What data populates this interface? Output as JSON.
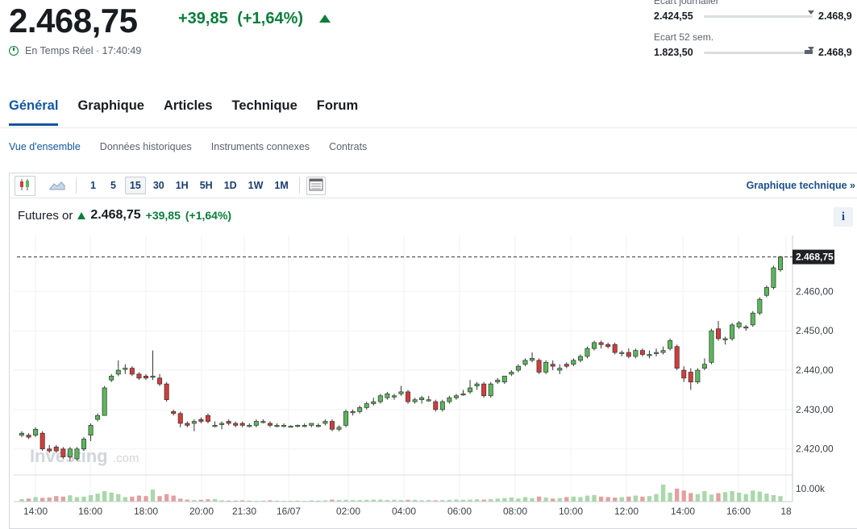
{
  "quote": {
    "price": "2.468,75",
    "change": "+39,85",
    "change_pct": "(+1,64%)",
    "realtime_label": "En Temps Réel · 17:40:49",
    "up_color": "#0a7e3a"
  },
  "ranges": {
    "daily": {
      "label": "Ecart journalier",
      "low": "2.424,55",
      "high": "2.468,9"
    },
    "week52": {
      "label": "Ecart 52 sem.",
      "low": "1.823,50",
      "high": "2.468,9"
    }
  },
  "main_tabs": [
    "Général",
    "Graphique",
    "Articles",
    "Technique",
    "Forum"
  ],
  "sub_tabs": [
    "Vue d'ensemble",
    "Données historiques",
    "Instruments connexes",
    "Contrats"
  ],
  "toolbar": {
    "icons": [
      "candlestick-icon",
      "area-chart-icon",
      "table-icon"
    ],
    "intervals": [
      "1",
      "5",
      "15",
      "30",
      "1H",
      "5H",
      "1D",
      "1W",
      "1M"
    ],
    "selected_interval": "15",
    "tech_link": "Graphique technique »"
  },
  "instrument": {
    "name": "Futures or",
    "price": "2.468,75",
    "change": "+39,85",
    "change_pct": "(+1,64%)"
  },
  "watermark": {
    "brand": "Investing",
    "suffix": ".com"
  },
  "chart_data": {
    "type": "candlestick",
    "y_ticks": [
      "2.420,00",
      "2.430,00",
      "2.440,00",
      "2.450,00",
      "2.460,00"
    ],
    "y_tick_values": [
      2420,
      2430,
      2440,
      2450,
      2460
    ],
    "ylim": [
      2413.6,
      2474.2
    ],
    "last_price_label": "2.468,75",
    "last_price": 2468.75,
    "volume_label": "10.00k",
    "x_ticks": [
      "14:00",
      "16:00",
      "18:00",
      "20:00",
      "21:30",
      "16/07",
      "02:00",
      "04:00",
      "06:00",
      "08:00",
      "10:00",
      "12:00",
      "14:00",
      "16:00",
      "18"
    ],
    "up_color": "#5bb75b",
    "down_color": "#d23c3c",
    "candles": [
      [
        2423.5,
        2424.5,
        2423.0,
        2424.0
      ],
      [
        2423.5,
        2424.0,
        2422.5,
        2423.0
      ],
      [
        2423.5,
        2425.5,
        2423.0,
        2425.0
      ],
      [
        2424.0,
        2424.5,
        2419.5,
        2420.0
      ],
      [
        2420.0,
        2421.0,
        2419.0,
        2419.5
      ],
      [
        2420.5,
        2421.0,
        2419.0,
        2419.5
      ],
      [
        2420.0,
        2420.5,
        2417.5,
        2418.0
      ],
      [
        2418.0,
        2420.5,
        2417.0,
        2420.0
      ],
      [
        2417.5,
        2420.5,
        2417.0,
        2420.0
      ],
      [
        2420.0,
        2423.0,
        2419.5,
        2422.5
      ],
      [
        2423.5,
        2426.5,
        2422.0,
        2426.0
      ],
      [
        2427.5,
        2429.0,
        2427.0,
        2428.5
      ],
      [
        2428.5,
        2436.0,
        2428.5,
        2435.5
      ],
      [
        2437.5,
        2439.0,
        2437.0,
        2438.5
      ],
      [
        2439.0,
        2442.5,
        2438.5,
        2440.0
      ],
      [
        2440.5,
        2441.5,
        2439.0,
        2440.5
      ],
      [
        2440.5,
        2441.0,
        2438.5,
        2439.0
      ],
      [
        2439.0,
        2439.5,
        2437.5,
        2438.0
      ],
      [
        2438.5,
        2439.0,
        2437.5,
        2438.0
      ],
      [
        2438.5,
        2445.0,
        2437.5,
        2438.5
      ],
      [
        2438.0,
        2439.0,
        2436.0,
        2436.5
      ],
      [
        2436.5,
        2437.0,
        2432.0,
        2432.5
      ],
      [
        2429.5,
        2430.0,
        2428.5,
        2429.0
      ],
      [
        2429.0,
        2429.5,
        2425.5,
        2426.5
      ],
      [
        2426.5,
        2427.0,
        2425.5,
        2426.0
      ],
      [
        2426.5,
        2427.5,
        2424.5,
        2427.0
      ],
      [
        2427.5,
        2428.0,
        2426.5,
        2427.0
      ],
      [
        2428.5,
        2429.0,
        2426.5,
        2427.0
      ],
      [
        2426.0,
        2427.0,
        2425.5,
        2426.0
      ],
      [
        2426.5,
        2427.0,
        2425.0,
        2426.5
      ],
      [
        2427.0,
        2427.5,
        2426.0,
        2426.5
      ],
      [
        2426.5,
        2427.0,
        2425.5,
        2426.0
      ],
      [
        2426.5,
        2427.0,
        2425.5,
        2426.0
      ],
      [
        2426.0,
        2426.5,
        2425.5,
        2426.0
      ],
      [
        2426.0,
        2427.5,
        2425.5,
        2427.0
      ],
      [
        2427.0,
        2427.5,
        2426.5,
        2427.0
      ],
      [
        2426.5,
        2427.0,
        2425.5,
        2426.0
      ],
      [
        2426.0,
        2426.5,
        2425.5,
        2426.0
      ],
      [
        2426.0,
        2426.5,
        2425.5,
        2426.0
      ],
      [
        2425.8,
        2426.0,
        2425.5,
        2425.8
      ],
      [
        2425.8,
        2426.2,
        2425.5,
        2426.0
      ],
      [
        2426.0,
        2426.5,
        2425.5,
        2426.0
      ],
      [
        2426.0,
        2426.5,
        2425.5,
        2426.5
      ],
      [
        2426.0,
        2426.5,
        2425.5,
        2426.0
      ],
      [
        2426.5,
        2427.5,
        2426.0,
        2427.0
      ],
      [
        2427.0,
        2427.5,
        2424.5,
        2425.0
      ],
      [
        2425.0,
        2426.0,
        2424.5,
        2425.5
      ],
      [
        2426.0,
        2430.0,
        2425.5,
        2429.5
      ],
      [
        2429.5,
        2430.0,
        2428.5,
        2429.5
      ],
      [
        2429.5,
        2431.0,
        2429.0,
        2430.5
      ],
      [
        2430.5,
        2432.0,
        2430.0,
        2431.5
      ],
      [
        2431.5,
        2433.0,
        2431.0,
        2432.0
      ],
      [
        2432.0,
        2434.0,
        2431.5,
        2433.5
      ],
      [
        2433.0,
        2434.5,
        2432.5,
        2434.0
      ],
      [
        2433.5,
        2434.0,
        2432.5,
        2433.5
      ],
      [
        2434.0,
        2436.0,
        2433.5,
        2434.5
      ],
      [
        2434.5,
        2435.0,
        2431.5,
        2432.0
      ],
      [
        2432.0,
        2433.0,
        2431.5,
        2432.5
      ],
      [
        2432.5,
        2433.5,
        2431.5,
        2433.0
      ],
      [
        2432.5,
        2433.5,
        2432.0,
        2432.5
      ],
      [
        2432.0,
        2432.5,
        2429.5,
        2430.0
      ],
      [
        2430.0,
        2432.5,
        2429.5,
        2432.0
      ],
      [
        2432.0,
        2433.5,
        2431.5,
        2433.0
      ],
      [
        2433.0,
        2434.0,
        2432.5,
        2433.5
      ],
      [
        2434.0,
        2435.0,
        2433.5,
        2434.0
      ],
      [
        2434.5,
        2437.5,
        2434.0,
        2435.5
      ],
      [
        2436.0,
        2437.0,
        2435.0,
        2436.5
      ],
      [
        2436.5,
        2437.0,
        2433.0,
        2433.5
      ],
      [
        2433.5,
        2437.0,
        2433.0,
        2436.5
      ],
      [
        2437.0,
        2438.0,
        2436.5,
        2437.5
      ],
      [
        2437.0,
        2438.5,
        2436.5,
        2438.5
      ],
      [
        2439.0,
        2440.0,
        2438.5,
        2439.5
      ],
      [
        2440.0,
        2441.5,
        2439.5,
        2441.0
      ],
      [
        2441.5,
        2443.0,
        2441.0,
        2442.5
      ],
      [
        2442.5,
        2444.5,
        2442.0,
        2443.0
      ],
      [
        2442.5,
        2443.0,
        2439.0,
        2439.5
      ],
      [
        2439.5,
        2442.5,
        2439.0,
        2442.0
      ],
      [
        2441.5,
        2442.5,
        2440.0,
        2441.0
      ],
      [
        2440.0,
        2441.5,
        2439.0,
        2440.5
      ],
      [
        2441.5,
        2442.0,
        2440.5,
        2441.0
      ],
      [
        2441.5,
        2443.0,
        2441.0,
        2442.5
      ],
      [
        2442.5,
        2444.0,
        2442.0,
        2443.5
      ],
      [
        2443.5,
        2446.0,
        2443.0,
        2445.5
      ],
      [
        2445.5,
        2447.5,
        2445.0,
        2447.0
      ],
      [
        2447.0,
        2447.5,
        2445.5,
        2446.5
      ],
      [
        2446.5,
        2447.0,
        2445.5,
        2446.0
      ],
      [
        2446.5,
        2447.0,
        2444.0,
        2444.5
      ],
      [
        2444.5,
        2445.0,
        2443.5,
        2444.5
      ],
      [
        2444.5,
        2445.5,
        2443.0,
        2443.5
      ],
      [
        2443.5,
        2445.5,
        2443.0,
        2445.0
      ],
      [
        2445.0,
        2445.5,
        2443.5,
        2444.0
      ],
      [
        2444.0,
        2445.0,
        2443.0,
        2444.0
      ],
      [
        2444.5,
        2445.5,
        2443.5,
        2444.5
      ],
      [
        2444.5,
        2446.0,
        2444.0,
        2445.0
      ],
      [
        2445.5,
        2448.0,
        2445.0,
        2447.5
      ],
      [
        2446.0,
        2446.5,
        2440.0,
        2440.5
      ],
      [
        2440.0,
        2441.0,
        2437.0,
        2438.0
      ],
      [
        2439.5,
        2440.5,
        2435.0,
        2437.0
      ],
      [
        2437.0,
        2440.5,
        2436.5,
        2440.0
      ],
      [
        2440.5,
        2443.0,
        2440.0,
        2441.5
      ],
      [
        2442.0,
        2450.5,
        2441.5,
        2450.0
      ],
      [
        2450.5,
        2452.5,
        2447.5,
        2448.0
      ],
      [
        2448.0,
        2448.5,
        2446.5,
        2448.0
      ],
      [
        2448.0,
        2452.0,
        2447.5,
        2451.5
      ],
      [
        2451.0,
        2452.5,
        2450.5,
        2452.0
      ],
      [
        2451.0,
        2451.5,
        2450.0,
        2451.0
      ],
      [
        2451.5,
        2455.0,
        2451.0,
        2454.5
      ],
      [
        2454.5,
        2458.5,
        2454.0,
        2458.0
      ],
      [
        2459.0,
        2461.5,
        2458.5,
        2461.0
      ],
      [
        2461.0,
        2466.5,
        2460.5,
        2466.0
      ],
      [
        2465.5,
        2469.0,
        2465.0,
        2468.75
      ]
    ],
    "volumes": [
      0.1,
      0.12,
      0.18,
      0.15,
      0.16,
      0.22,
      0.2,
      0.25,
      0.18,
      0.2,
      0.26,
      0.32,
      0.42,
      0.36,
      0.3,
      0.18,
      0.2,
      0.24,
      0.22,
      0.48,
      0.22,
      0.3,
      0.24,
      0.12,
      0.08,
      0.06,
      0.07,
      0.09,
      0.1,
      0.05,
      0.04,
      0.04,
      0.05,
      0.04,
      0.03,
      0.04,
      0.05,
      0.04,
      0.03,
      0.03,
      0.04,
      0.03,
      0.05,
      0.04,
      0.05,
      0.08,
      0.06,
      0.07,
      0.06,
      0.06,
      0.07,
      0.08,
      0.08,
      0.06,
      0.07,
      0.06,
      0.07,
      0.07,
      0.05,
      0.06,
      0.05,
      0.06,
      0.07,
      0.08,
      0.07,
      0.08,
      0.09,
      0.08,
      0.1,
      0.12,
      0.14,
      0.16,
      0.12,
      0.18,
      0.14,
      0.2,
      0.16,
      0.12,
      0.14,
      0.18,
      0.2,
      0.18,
      0.24,
      0.26,
      0.2,
      0.18,
      0.16,
      0.18,
      0.2,
      0.24,
      0.2,
      0.22,
      0.3,
      0.68,
      0.36,
      0.52,
      0.44,
      0.34,
      0.3,
      0.42,
      0.28,
      0.34,
      0.38,
      0.42,
      0.36,
      0.3,
      0.44,
      0.4,
      0.32,
      0.26,
      0.22
    ]
  }
}
